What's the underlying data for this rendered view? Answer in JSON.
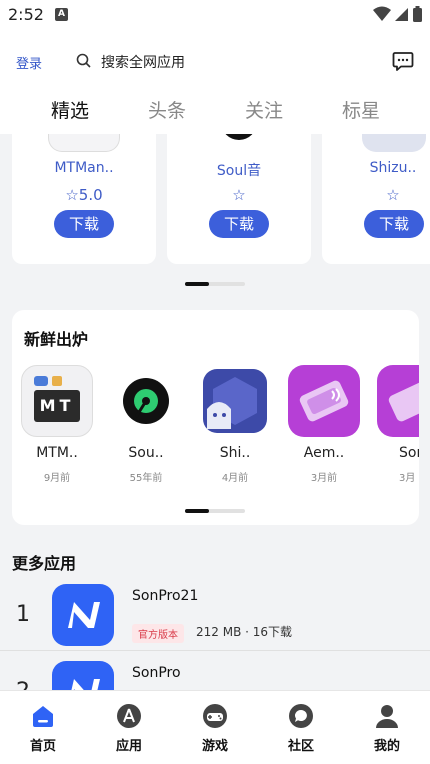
{
  "status_bar": {
    "time": "2:52",
    "notification_letter": "A"
  },
  "header": {
    "login_label": "登录",
    "search_placeholder": "搜索全网应用",
    "tabs": [
      {
        "label": "精选",
        "active": true
      },
      {
        "label": "头条",
        "active": false
      },
      {
        "label": "关注",
        "active": false
      },
      {
        "label": "标星",
        "active": false
      }
    ]
  },
  "featured": {
    "cards": [
      {
        "name": "MTMan..",
        "rating": "☆5.0",
        "button": "下载"
      },
      {
        "name": "Soul音",
        "rating": "☆",
        "button": "下载"
      },
      {
        "name": "Shizu..",
        "rating": "☆",
        "button": "下载"
      }
    ]
  },
  "fresh": {
    "title": "新鲜出炉",
    "items": [
      {
        "name": "MTM..",
        "time": "9月前",
        "icon": "mt-manager-icon",
        "icon_label": "MT"
      },
      {
        "name": "Sou..",
        "time": "55年前",
        "icon": "soul-music-icon"
      },
      {
        "name": "Shi..",
        "time": "4月前",
        "icon": "shizuku-icon"
      },
      {
        "name": "Aem..",
        "time": "3月前",
        "icon": "aemulator-icon"
      },
      {
        "name": "Son",
        "time": "3月",
        "icon": "sonpro-purple-icon"
      }
    ]
  },
  "more_apps": {
    "title": "更多应用",
    "items": [
      {
        "rank": "1",
        "name": "SonPro21",
        "badge": "官方版本",
        "meta": "212 MB · 16下载"
      },
      {
        "rank": "2",
        "name": "SonPro",
        "badge": "",
        "meta": ""
      }
    ]
  },
  "bottom_nav": [
    {
      "label": "首页",
      "icon": "home-icon",
      "active": true
    },
    {
      "label": "应用",
      "icon": "appstore-icon",
      "active": false
    },
    {
      "label": "游戏",
      "icon": "gamepad-icon",
      "active": false
    },
    {
      "label": "社区",
      "icon": "chat-bubble-icon",
      "active": false
    },
    {
      "label": "我的",
      "icon": "user-icon",
      "active": false
    }
  ],
  "colors": {
    "accent": "#3c5fdb",
    "background": "#f2f3f5",
    "badge_text": "#d93c4a"
  }
}
